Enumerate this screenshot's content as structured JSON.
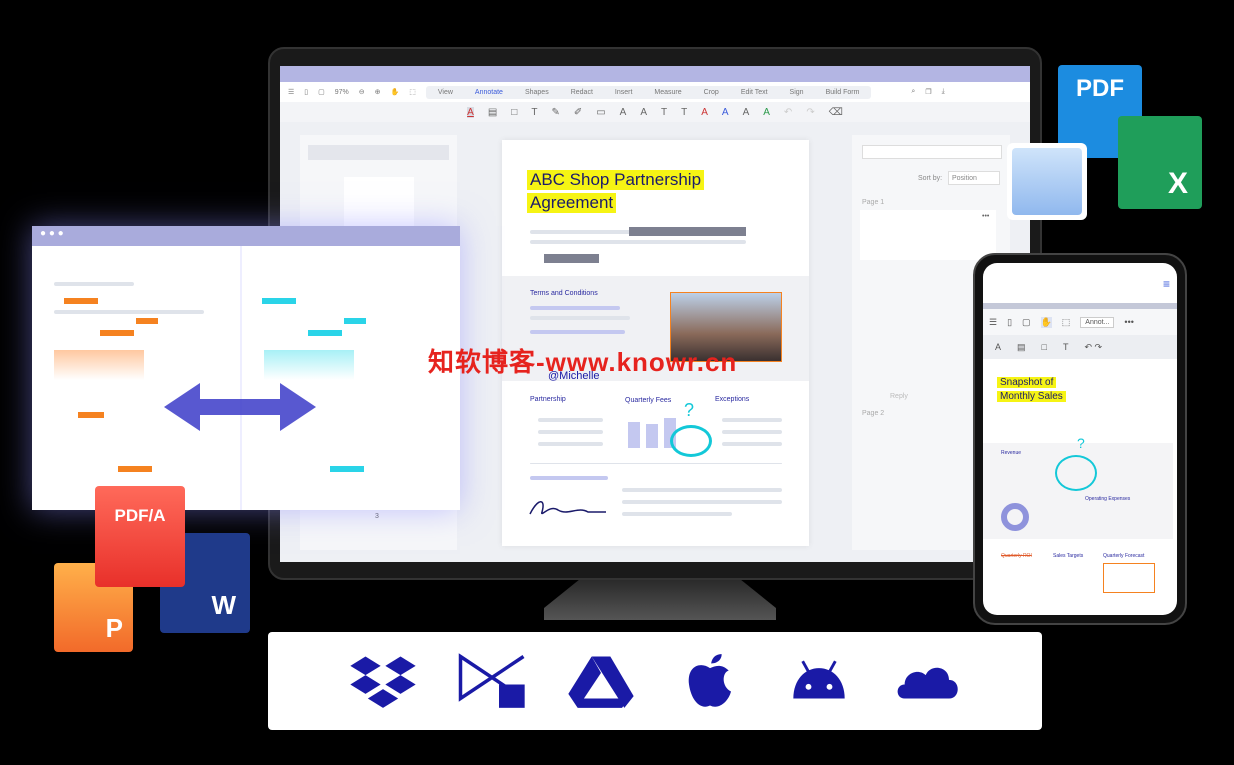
{
  "toolbar": {
    "zoom": "97%",
    "menu": [
      "View",
      "Annotate",
      "Shapes",
      "Redact",
      "Insert",
      "Measure",
      "Crop",
      "Edit Text",
      "Sign",
      "Build Form"
    ],
    "active": "Annotate"
  },
  "doc": {
    "title_line1": "ABC Shop Partnership",
    "title_line2": "Agreement",
    "terms": "Terms and Conditions",
    "mention": "@Michelle",
    "partnership": "Partnership",
    "fees": "Quarterly Fees",
    "exceptions": "Exceptions",
    "question": "?"
  },
  "comments": {
    "sort_label": "Sort by:",
    "sort_value": "Position",
    "page1": "Page 1",
    "page2": "Page 2",
    "reply": "Reply",
    "more": "•••"
  },
  "thumbs": {
    "page_number": "3"
  },
  "phone": {
    "mode": "Annot...",
    "title_line1": "Snapshot of",
    "title_line2": "Monthly Sales",
    "revenue": "Revenue",
    "opex": "Operating Expenses",
    "roi": "Quarterly ROI",
    "targets": "Sales Targets",
    "forecast": "Quarterly Forecast",
    "question": "?"
  },
  "files": {
    "pdf": "PDF",
    "excel": "X",
    "pdfa": "PDF/A",
    "ppt": "P",
    "word": "W"
  },
  "watermark": "知软博客-www.knowr.cn",
  "integrations": [
    "dropbox-icon",
    "sharepoint-icon",
    "google-drive-icon",
    "apple-icon",
    "android-icon",
    "onedrive-icon"
  ],
  "colors": {
    "accent": "#1a1aa6",
    "highlight": "#f6f414",
    "orange": "#f58220",
    "cyan": "#13c8d8"
  }
}
